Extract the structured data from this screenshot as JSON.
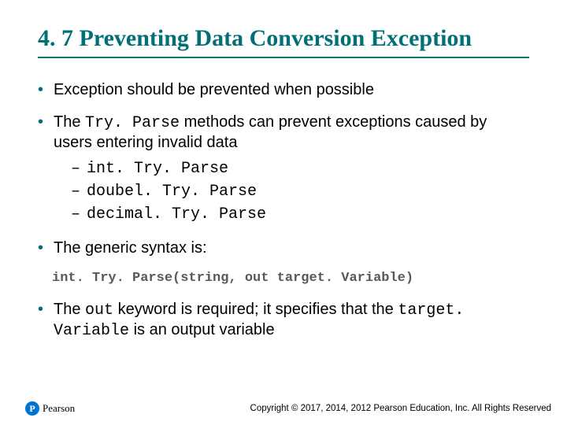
{
  "title": "4. 7 Preventing Data Conversion Exception",
  "bullets": {
    "b1": "Exception should be prevented when possible",
    "b2_pre": "The ",
    "b2_code": "Try. Parse",
    "b2_post": " methods can prevent exceptions caused by users entering invalid data",
    "b2_sub1": "int. Try. Parse",
    "b2_sub2": "doubel. Try. Parse",
    "b2_sub3": "decimal. Try. Parse",
    "b3": "The generic syntax is:",
    "b4_pre": "The ",
    "b4_code1": "out",
    "b4_mid": " keyword is required; it specifies that the ",
    "b4_code2": "target. Variable",
    "b4_post": " is an output variable"
  },
  "code_line": "int. Try. Parse(string, out target. Variable)",
  "logo": {
    "letter": "P",
    "brand": "Pearson"
  },
  "copyright": "Copyright © 2017, 2014, 2012 Pearson Education, Inc. All Rights Reserved"
}
